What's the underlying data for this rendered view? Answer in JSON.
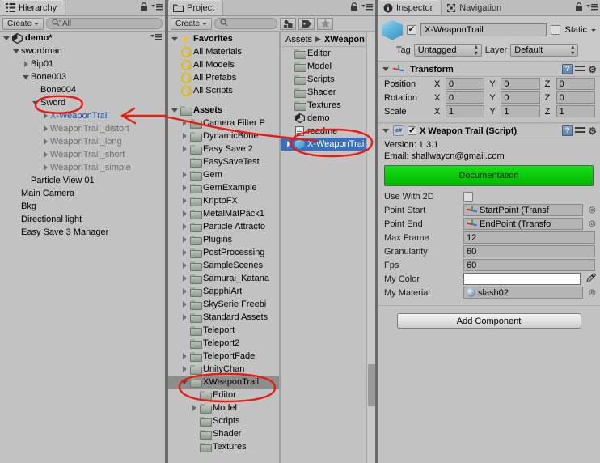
{
  "hierarchy": {
    "tab_label": "Hierarchy",
    "tab_icon": "hierarchy-icon",
    "create_label": "Create",
    "search_placeholder": "All",
    "search_icon": "search-icon",
    "scene_name": "demo*",
    "items": [
      {
        "label": "swordman",
        "indent": 1,
        "arrow": "down",
        "style": "normal"
      },
      {
        "label": "Bip01",
        "indent": 2,
        "arrow": "right",
        "style": "normal"
      },
      {
        "label": "Bone003",
        "indent": 2,
        "arrow": "down",
        "style": "normal"
      },
      {
        "label": "Bone004",
        "indent": 3,
        "arrow": "none",
        "style": "normal"
      },
      {
        "label": "Sword",
        "indent": 3,
        "arrow": "down",
        "style": "normal"
      },
      {
        "label": "X-WeaponTrail",
        "indent": 4,
        "arrow": "right",
        "style": "blue"
      },
      {
        "label": "WeaponTrail_distort",
        "indent": 4,
        "arrow": "right",
        "style": "dim"
      },
      {
        "label": "WeaponTrail_long",
        "indent": 4,
        "arrow": "right",
        "style": "dim"
      },
      {
        "label": "WeaponTrail_short",
        "indent": 4,
        "arrow": "right",
        "style": "dim"
      },
      {
        "label": "WeaponTrail_simple",
        "indent": 4,
        "arrow": "right",
        "style": "dim"
      },
      {
        "label": "Particle View 01",
        "indent": 2,
        "arrow": "none",
        "style": "normal"
      },
      {
        "label": "Main Camera",
        "indent": 1,
        "arrow": "none",
        "style": "normal"
      },
      {
        "label": "Bkg",
        "indent": 1,
        "arrow": "none",
        "style": "normal"
      },
      {
        "label": "Directional light",
        "indent": 1,
        "arrow": "none",
        "style": "normal"
      },
      {
        "label": "Easy Save 3 Manager",
        "indent": 1,
        "arrow": "none",
        "style": "normal"
      }
    ]
  },
  "project": {
    "tab_label": "Project",
    "tab_icon": "folder-icon",
    "create_label": "Create",
    "search_placeholder": "",
    "search_icon": "search-icon",
    "toolbar_icons": [
      "asset-filter-icon",
      "label-filter-icon",
      "favorite-star-icon"
    ],
    "favorites_label": "Favorites",
    "favorites": [
      {
        "label": "All Materials",
        "icon": "magnifier-icon"
      },
      {
        "label": "All Models",
        "icon": "magnifier-icon"
      },
      {
        "label": "All Prefabs",
        "icon": "magnifier-icon"
      },
      {
        "label": "All Scripts",
        "icon": "magnifier-icon"
      }
    ],
    "assets_label": "Assets",
    "tree": [
      {
        "label": "Camera Filter P",
        "indent": 1,
        "arrow": "right",
        "selected": false
      },
      {
        "label": "DynamicBone",
        "indent": 1,
        "arrow": "right",
        "selected": false
      },
      {
        "label": "Easy Save 2",
        "indent": 1,
        "arrow": "right",
        "selected": false
      },
      {
        "label": "EasySaveTest",
        "indent": 1,
        "arrow": "none",
        "selected": false
      },
      {
        "label": "Gem",
        "indent": 1,
        "arrow": "right",
        "selected": false
      },
      {
        "label": "GemExample",
        "indent": 1,
        "arrow": "right",
        "selected": false
      },
      {
        "label": "KriptoFX",
        "indent": 1,
        "arrow": "right",
        "selected": false
      },
      {
        "label": "MetalMatPack1",
        "indent": 1,
        "arrow": "right",
        "selected": false
      },
      {
        "label": "Particle Attracto",
        "indent": 1,
        "arrow": "right",
        "selected": false
      },
      {
        "label": "Plugins",
        "indent": 1,
        "arrow": "right",
        "selected": false
      },
      {
        "label": "PostProcessing",
        "indent": 1,
        "arrow": "right",
        "selected": false
      },
      {
        "label": "SampleScenes",
        "indent": 1,
        "arrow": "right",
        "selected": false
      },
      {
        "label": "Samurai_Katana",
        "indent": 1,
        "arrow": "right",
        "selected": false
      },
      {
        "label": "SapphiArt",
        "indent": 1,
        "arrow": "right",
        "selected": false
      },
      {
        "label": "SkySerie Freebi",
        "indent": 1,
        "arrow": "right",
        "selected": false
      },
      {
        "label": "Standard Assets",
        "indent": 1,
        "arrow": "right",
        "selected": false
      },
      {
        "label": "Teleport",
        "indent": 1,
        "arrow": "none",
        "selected": false
      },
      {
        "label": "Teleport2",
        "indent": 1,
        "arrow": "none",
        "selected": false
      },
      {
        "label": "TeleportFade",
        "indent": 1,
        "arrow": "right",
        "selected": false
      },
      {
        "label": "UnityChan",
        "indent": 1,
        "arrow": "right",
        "selected": false
      },
      {
        "label": "XWeaponTrail",
        "indent": 1,
        "arrow": "down",
        "selected": true
      },
      {
        "label": "Editor",
        "indent": 2,
        "arrow": "none",
        "selected": false
      },
      {
        "label": "Model",
        "indent": 2,
        "arrow": "right",
        "selected": false
      },
      {
        "label": "Scripts",
        "indent": 2,
        "arrow": "none",
        "selected": false
      },
      {
        "label": "Shader",
        "indent": 2,
        "arrow": "none",
        "selected": false
      },
      {
        "label": "Textures",
        "indent": 2,
        "arrow": "none",
        "selected": false
      }
    ],
    "breadcrumb": {
      "root": "Assets",
      "current": "XWeapon"
    },
    "contents": [
      {
        "label": "Editor",
        "icon": "folder-icon",
        "arrow": "none",
        "selected": false
      },
      {
        "label": "Model",
        "icon": "folder-icon",
        "arrow": "none",
        "selected": false
      },
      {
        "label": "Scripts",
        "icon": "folder-icon",
        "arrow": "none",
        "selected": false
      },
      {
        "label": "Shader",
        "icon": "folder-icon",
        "arrow": "none",
        "selected": false
      },
      {
        "label": "Textures",
        "icon": "folder-icon",
        "arrow": "none",
        "selected": false
      },
      {
        "label": "demo",
        "icon": "unity-scene-icon",
        "arrow": "none",
        "selected": false
      },
      {
        "label": "readme",
        "icon": "text-file-icon",
        "arrow": "none",
        "selected": false
      },
      {
        "label": "X-WeaponTrail",
        "icon": "prefab-cube-icon",
        "arrow": "right",
        "selected": true
      }
    ]
  },
  "inspector": {
    "tabs": [
      {
        "label": "Inspector",
        "icon": "info-icon",
        "active": true
      },
      {
        "label": "Navigation",
        "icon": "navigation-icon",
        "active": false
      }
    ],
    "object_name": "X-WeaponTrail",
    "object_enabled": true,
    "static_label": "Static",
    "static_checked": false,
    "tag_label": "Tag",
    "tag_value": "Untagged",
    "layer_label": "Layer",
    "layer_value": "Default",
    "transform": {
      "title": "Transform",
      "icon": "transform-axis-icon",
      "rows": [
        {
          "label": "Position",
          "x": "0",
          "y": "0",
          "z": "0"
        },
        {
          "label": "Rotation",
          "x": "0",
          "y": "0",
          "z": "0"
        },
        {
          "label": "Scale",
          "x": "1",
          "y": "1",
          "z": "1"
        }
      ]
    },
    "script": {
      "title": "X Weapon Trail (Script)",
      "enabled": true,
      "version_line": "Version: 1.3.1",
      "email_line": "Email: shallwaycn@gmail.com",
      "doc_button": "Documentation",
      "doc_button_color": "#00c800",
      "properties": [
        {
          "label": "Use With 2D",
          "type": "checkbox",
          "value": "",
          "checked": false
        },
        {
          "label": "Point Start",
          "type": "object",
          "value": "StartPoint (Transf",
          "icon": "transform-axis-icon"
        },
        {
          "label": "Point End",
          "type": "object",
          "value": "EndPoint (Transfo",
          "icon": "transform-axis-icon"
        },
        {
          "label": "Max Frame",
          "type": "number",
          "value": "12"
        },
        {
          "label": "Granularity",
          "type": "number",
          "value": "60"
        },
        {
          "label": "Fps",
          "type": "number",
          "value": "60"
        },
        {
          "label": "My Color",
          "type": "color",
          "value": "",
          "swatch": "#ffffff"
        },
        {
          "label": "My Material",
          "type": "object",
          "value": "slash02",
          "icon": "material-sphere-icon"
        }
      ]
    },
    "add_component_label": "Add Component",
    "header_icons": [
      "help-book-icon",
      "preset-icon",
      "gear-icon"
    ]
  },
  "annotations": {
    "color": "#e81c13",
    "marks": [
      "circle-around-sword",
      "arrow-to-x-weapontrail-hierarchy",
      "circle-around-x-weapontrail-prefab",
      "circle-around-xweapontrail-folder"
    ]
  }
}
